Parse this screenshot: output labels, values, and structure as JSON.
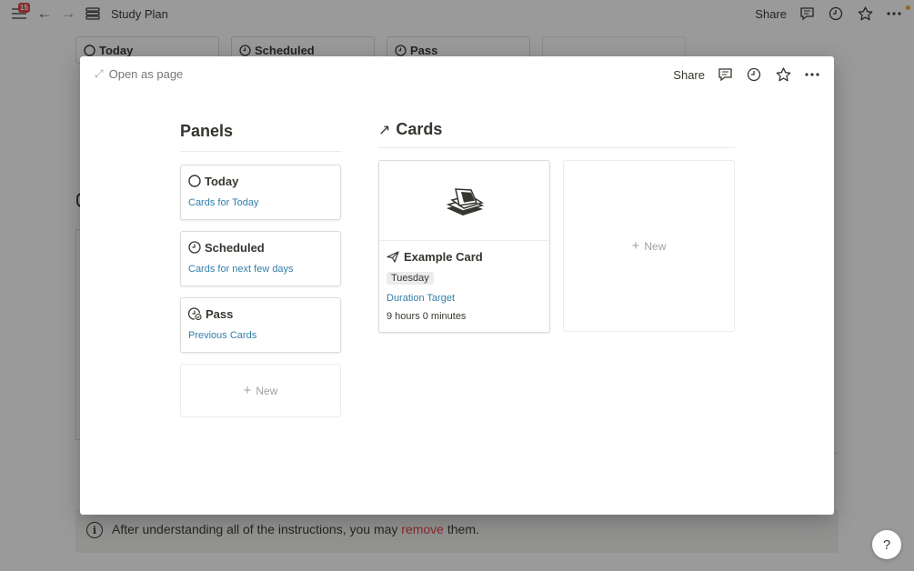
{
  "topbar": {
    "notification_count": "15",
    "title": "Study Plan",
    "share_label": "Share"
  },
  "background_board": {
    "columns": [
      "Today",
      "Scheduled",
      "Pass"
    ]
  },
  "callout": {
    "text_before": "After understanding all of the instructions, you may ",
    "highlight": "remove",
    "text_after": " them.",
    "highlight_color": "#e03e3e"
  },
  "help_label": "?",
  "modal": {
    "open_as_page": "Open as page",
    "share_label": "Share",
    "panels": {
      "title": "Panels",
      "items": [
        {
          "name": "Today",
          "link": "Cards for Today",
          "icon": "circle-icon"
        },
        {
          "name": "Scheduled",
          "link": "Cards for next few days",
          "icon": "clock-icon"
        },
        {
          "name": "Pass",
          "link": "Previous Cards",
          "icon": "pass-check-icon"
        }
      ],
      "new_label": "New"
    },
    "cards": {
      "title": "Cards",
      "items": [
        {
          "title": "Example Card",
          "tag": "Tuesday",
          "property": "Duration Target",
          "duration": "9 hours 0 minutes"
        }
      ],
      "new_label": "New"
    }
  },
  "colors": {
    "link": "#337ea9",
    "tag_bg": "#ebeced",
    "badge": "#e03e3e"
  }
}
